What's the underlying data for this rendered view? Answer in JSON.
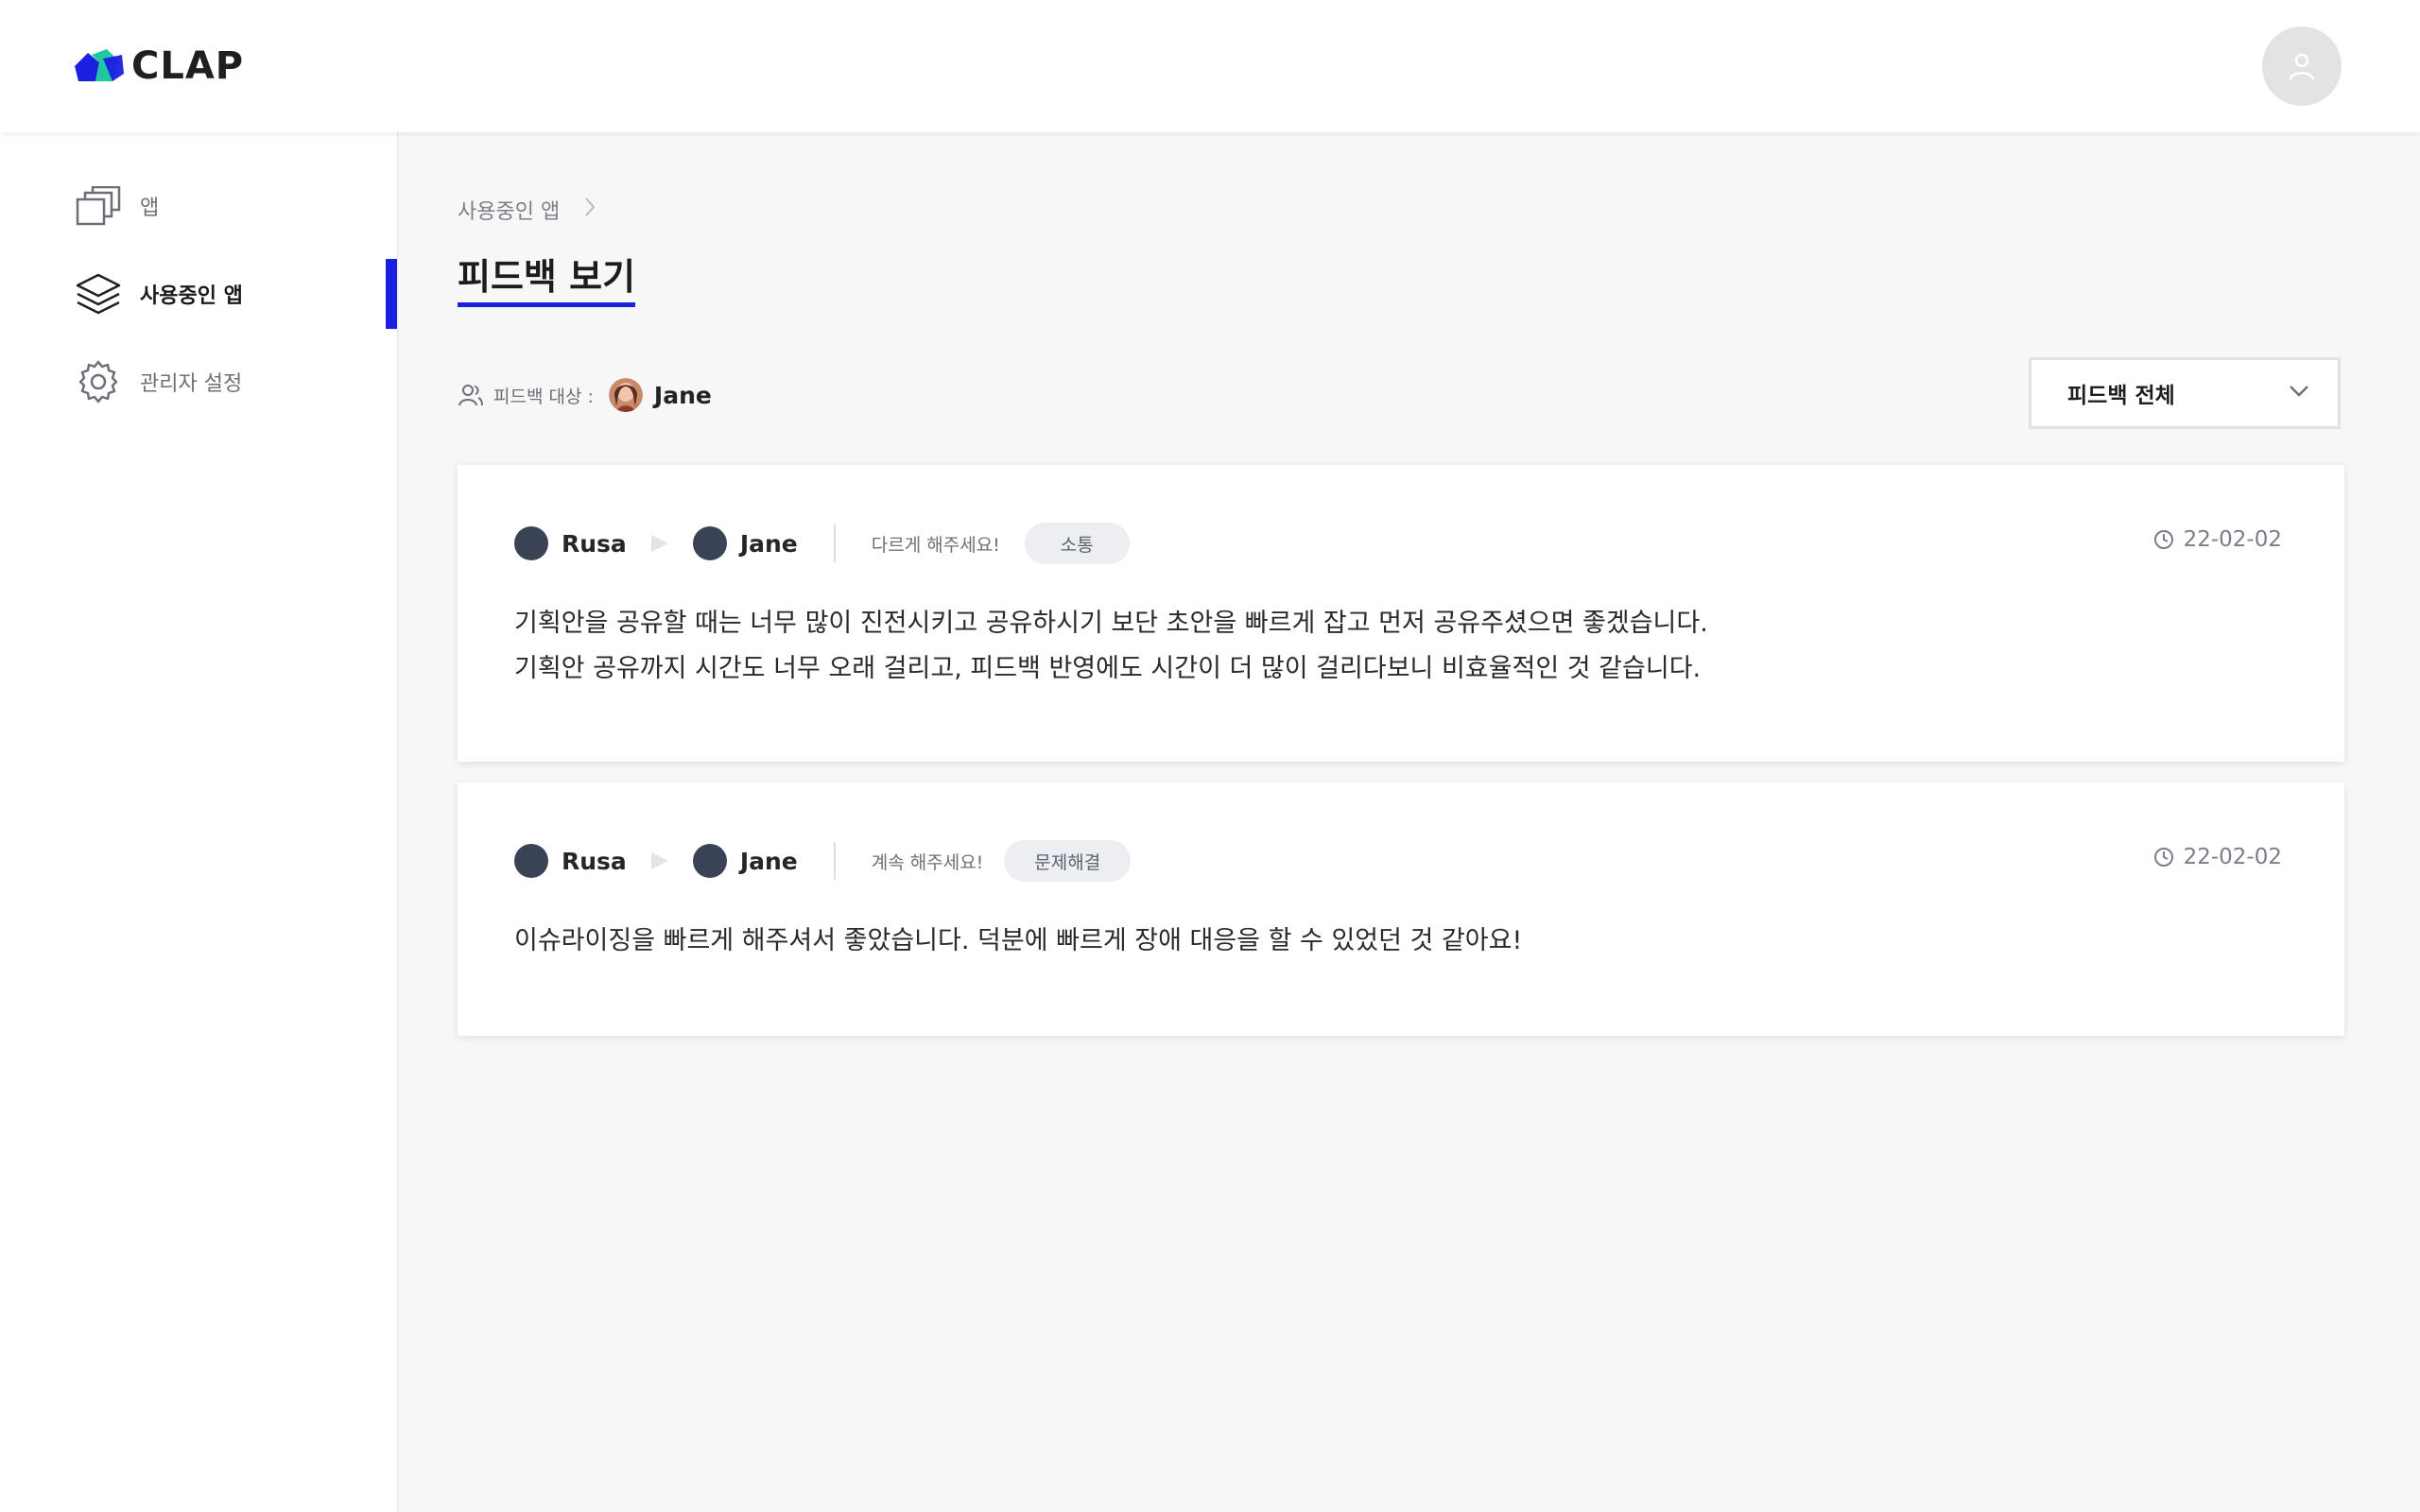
{
  "header": {
    "logo_text": "CLAP",
    "brand_colors": {
      "primary": "#1a1fe0",
      "secondary": "#1ec8a0"
    },
    "account_icon": "user-icon"
  },
  "sidebar": {
    "items": [
      {
        "label": "앱",
        "icon": "windows-stack-icon",
        "active": false
      },
      {
        "label": "사용중인 앱",
        "icon": "layers-icon",
        "active": true
      },
      {
        "label": "관리자 설정",
        "icon": "gear-icon",
        "active": false
      }
    ]
  },
  "main": {
    "breadcrumb": {
      "item": "사용중인 앱"
    },
    "title": "피드백 보기",
    "target": {
      "label": "피드백 대상 :",
      "name": "Jane"
    },
    "filter": {
      "selected": "피드백 전체"
    },
    "feedbacks": [
      {
        "from": "Rusa",
        "to": "Jane",
        "type": "다르게 해주세요!",
        "tag": "소통",
        "date": "22-02-02",
        "content": "기획안을 공유할 때는 너무 많이 진전시키고 공유하시기 보단 초안을 빠르게 잡고 먼저 공유주셨으면 좋겠습니다.\n기획안 공유까지 시간도 너무 오래 걸리고, 피드백 반영에도 시간이 더 많이 걸리다보니 비효율적인 것 같습니다."
      },
      {
        "from": "Rusa",
        "to": "Jane",
        "type": "계속 해주세요!",
        "tag": "문제해결",
        "date": "22-02-02",
        "content": "이슈라이징을 빠르게 해주셔서 좋았습니다. 덕분에 빠르게 장애 대응을 할 수 있었던 것 같아요!"
      }
    ]
  }
}
